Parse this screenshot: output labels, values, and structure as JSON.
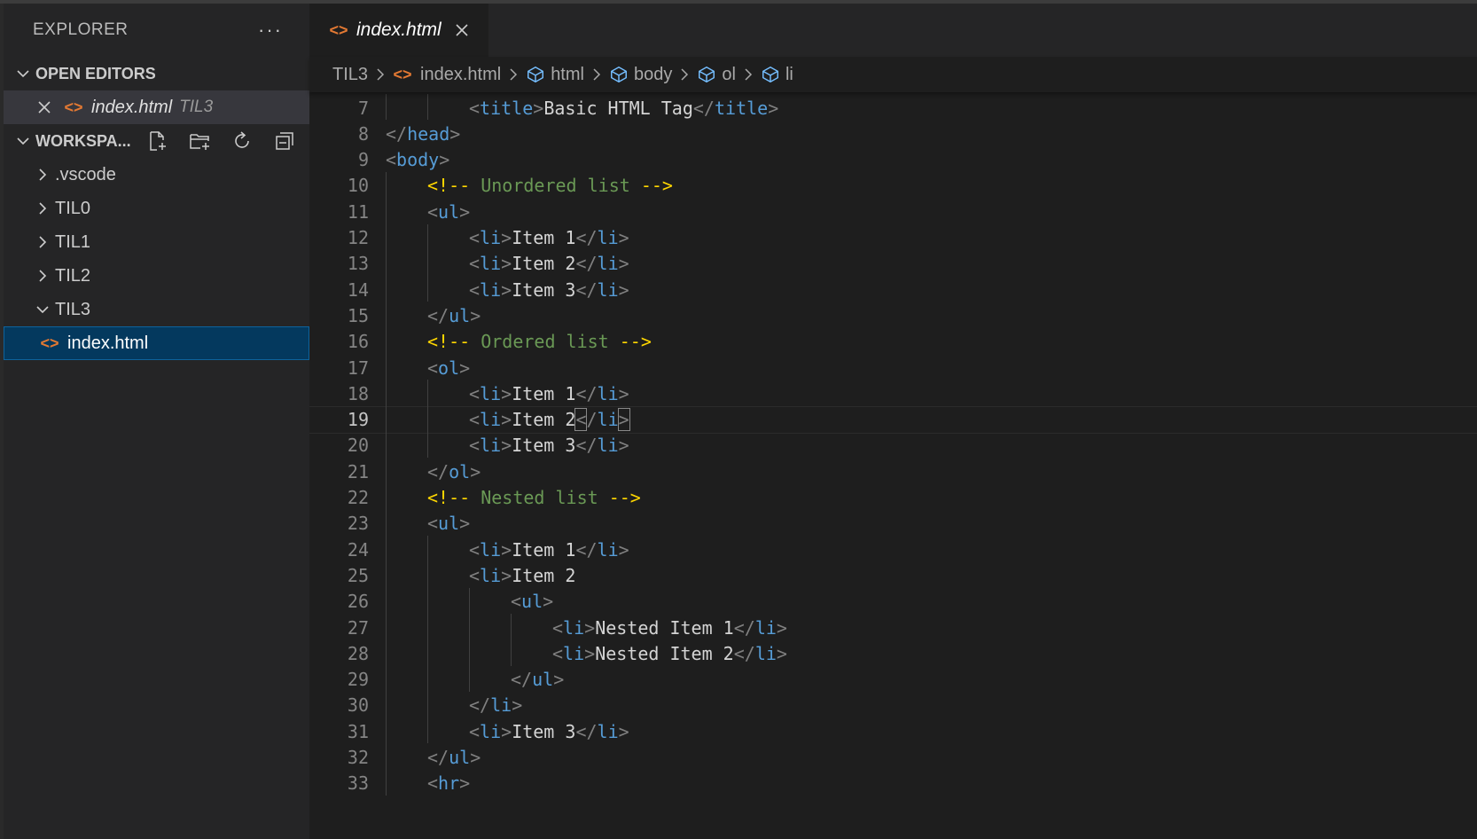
{
  "sidebar": {
    "title": "EXPLORER",
    "more": "···",
    "open_editors_label": "OPEN EDITORS",
    "open_editor": {
      "name": "index.html",
      "folder": "TIL3"
    },
    "workspace_label": "WORKSPA...",
    "tree": [
      {
        "name": ".vscode",
        "expanded": false
      },
      {
        "name": "TIL0",
        "expanded": false
      },
      {
        "name": "TIL1",
        "expanded": false
      },
      {
        "name": "TIL2",
        "expanded": false
      },
      {
        "name": "TIL3",
        "expanded": true
      }
    ],
    "selected_file": "index.html"
  },
  "tab": {
    "name": "index.html"
  },
  "breadcrumbs": {
    "folder": "TIL3",
    "file": "index.html",
    "symbols": [
      "html",
      "body",
      "ol",
      "li"
    ]
  },
  "editor": {
    "current_line": 19,
    "lines": [
      {
        "n": "7",
        "indent": 2,
        "parts": [
          [
            "brk",
            "<"
          ],
          [
            "tag",
            "title"
          ],
          [
            "brk",
            ">"
          ],
          [
            "txt",
            "Basic HTML Tag"
          ],
          [
            "brk",
            "</"
          ],
          [
            "tag",
            "title"
          ],
          [
            "brk",
            ">"
          ]
        ]
      },
      {
        "n": "8",
        "indent": 0,
        "parts": [
          [
            "brk",
            "</"
          ],
          [
            "tag",
            "head"
          ],
          [
            "brk",
            ">"
          ]
        ]
      },
      {
        "n": "9",
        "indent": 0,
        "parts": [
          [
            "brk",
            "<"
          ],
          [
            "tag",
            "body"
          ],
          [
            "brk",
            ">"
          ]
        ]
      },
      {
        "n": "10",
        "indent": 1,
        "parts": [
          [
            "cmd",
            "<!--"
          ],
          [
            "cm",
            " Unordered list "
          ],
          [
            "cmd",
            "-->"
          ]
        ]
      },
      {
        "n": "11",
        "indent": 1,
        "parts": [
          [
            "brk",
            "<"
          ],
          [
            "tag",
            "ul"
          ],
          [
            "brk",
            ">"
          ]
        ]
      },
      {
        "n": "12",
        "indent": 2,
        "parts": [
          [
            "brk",
            "<"
          ],
          [
            "tag",
            "li"
          ],
          [
            "brk",
            ">"
          ],
          [
            "txt",
            "Item 1"
          ],
          [
            "brk",
            "</"
          ],
          [
            "tag",
            "li"
          ],
          [
            "brk",
            ">"
          ]
        ]
      },
      {
        "n": "13",
        "indent": 2,
        "parts": [
          [
            "brk",
            "<"
          ],
          [
            "tag",
            "li"
          ],
          [
            "brk",
            ">"
          ],
          [
            "txt",
            "Item 2"
          ],
          [
            "brk",
            "</"
          ],
          [
            "tag",
            "li"
          ],
          [
            "brk",
            ">"
          ]
        ]
      },
      {
        "n": "14",
        "indent": 2,
        "parts": [
          [
            "brk",
            "<"
          ],
          [
            "tag",
            "li"
          ],
          [
            "brk",
            ">"
          ],
          [
            "txt",
            "Item 3"
          ],
          [
            "brk",
            "</"
          ],
          [
            "tag",
            "li"
          ],
          [
            "brk",
            ">"
          ]
        ]
      },
      {
        "n": "15",
        "indent": 1,
        "parts": [
          [
            "brk",
            "</"
          ],
          [
            "tag",
            "ul"
          ],
          [
            "brk",
            ">"
          ]
        ]
      },
      {
        "n": "16",
        "indent": 1,
        "parts": [
          [
            "cmd",
            "<!--"
          ],
          [
            "cm",
            " Ordered list "
          ],
          [
            "cmd",
            "-->"
          ]
        ]
      },
      {
        "n": "17",
        "indent": 1,
        "parts": [
          [
            "brk",
            "<"
          ],
          [
            "tag",
            "ol"
          ],
          [
            "brk",
            ">"
          ]
        ]
      },
      {
        "n": "18",
        "indent": 2,
        "parts": [
          [
            "brk",
            "<"
          ],
          [
            "tag",
            "li"
          ],
          [
            "brk",
            ">"
          ],
          [
            "txt",
            "Item 1"
          ],
          [
            "brk",
            "</"
          ],
          [
            "tag",
            "li"
          ],
          [
            "brk",
            ">"
          ]
        ]
      },
      {
        "n": "19",
        "indent": 2,
        "parts": [
          [
            "brk",
            "<"
          ],
          [
            "tag",
            "li"
          ],
          [
            "brk",
            ">"
          ],
          [
            "txt",
            "Item 2"
          ],
          [
            "bm",
            "<"
          ],
          [
            "brk",
            "/"
          ],
          [
            "tag",
            "li"
          ],
          [
            "bm",
            ">"
          ]
        ]
      },
      {
        "n": "20",
        "indent": 2,
        "parts": [
          [
            "brk",
            "<"
          ],
          [
            "tag",
            "li"
          ],
          [
            "brk",
            ">"
          ],
          [
            "txt",
            "Item 3"
          ],
          [
            "brk",
            "</"
          ],
          [
            "tag",
            "li"
          ],
          [
            "brk",
            ">"
          ]
        ]
      },
      {
        "n": "21",
        "indent": 1,
        "parts": [
          [
            "brk",
            "</"
          ],
          [
            "tag",
            "ol"
          ],
          [
            "brk",
            ">"
          ]
        ]
      },
      {
        "n": "22",
        "indent": 1,
        "parts": [
          [
            "cmd",
            "<!--"
          ],
          [
            "cm",
            " Nested list "
          ],
          [
            "cmd",
            "-->"
          ]
        ]
      },
      {
        "n": "23",
        "indent": 1,
        "parts": [
          [
            "brk",
            "<"
          ],
          [
            "tag",
            "ul"
          ],
          [
            "brk",
            ">"
          ]
        ]
      },
      {
        "n": "24",
        "indent": 2,
        "parts": [
          [
            "brk",
            "<"
          ],
          [
            "tag",
            "li"
          ],
          [
            "brk",
            ">"
          ],
          [
            "txt",
            "Item 1"
          ],
          [
            "brk",
            "</"
          ],
          [
            "tag",
            "li"
          ],
          [
            "brk",
            ">"
          ]
        ]
      },
      {
        "n": "25",
        "indent": 2,
        "parts": [
          [
            "brk",
            "<"
          ],
          [
            "tag",
            "li"
          ],
          [
            "brk",
            ">"
          ],
          [
            "txt",
            "Item 2"
          ]
        ]
      },
      {
        "n": "26",
        "indent": 3,
        "parts": [
          [
            "brk",
            "<"
          ],
          [
            "tag",
            "ul"
          ],
          [
            "brk",
            ">"
          ]
        ]
      },
      {
        "n": "27",
        "indent": 4,
        "parts": [
          [
            "brk",
            "<"
          ],
          [
            "tag",
            "li"
          ],
          [
            "brk",
            ">"
          ],
          [
            "txt",
            "Nested Item 1"
          ],
          [
            "brk",
            "</"
          ],
          [
            "tag",
            "li"
          ],
          [
            "brk",
            ">"
          ]
        ]
      },
      {
        "n": "28",
        "indent": 4,
        "parts": [
          [
            "brk",
            "<"
          ],
          [
            "tag",
            "li"
          ],
          [
            "brk",
            ">"
          ],
          [
            "txt",
            "Nested Item 2"
          ],
          [
            "brk",
            "</"
          ],
          [
            "tag",
            "li"
          ],
          [
            "brk",
            ">"
          ]
        ]
      },
      {
        "n": "29",
        "indent": 3,
        "parts": [
          [
            "brk",
            "</"
          ],
          [
            "tag",
            "ul"
          ],
          [
            "brk",
            ">"
          ]
        ]
      },
      {
        "n": "30",
        "indent": 2,
        "parts": [
          [
            "brk",
            "</"
          ],
          [
            "tag",
            "li"
          ],
          [
            "brk",
            ">"
          ]
        ]
      },
      {
        "n": "31",
        "indent": 2,
        "parts": [
          [
            "brk",
            "<"
          ],
          [
            "tag",
            "li"
          ],
          [
            "brk",
            ">"
          ],
          [
            "txt",
            "Item 3"
          ],
          [
            "brk",
            "</"
          ],
          [
            "tag",
            "li"
          ],
          [
            "brk",
            ">"
          ]
        ]
      },
      {
        "n": "32",
        "indent": 1,
        "parts": [
          [
            "brk",
            "</"
          ],
          [
            "tag",
            "ul"
          ],
          [
            "brk",
            ">"
          ]
        ]
      },
      {
        "n": "33",
        "indent": 1,
        "parts": [
          [
            "brk",
            "<"
          ],
          [
            "tag",
            "hr"
          ],
          [
            "brk",
            ">"
          ]
        ]
      }
    ]
  }
}
